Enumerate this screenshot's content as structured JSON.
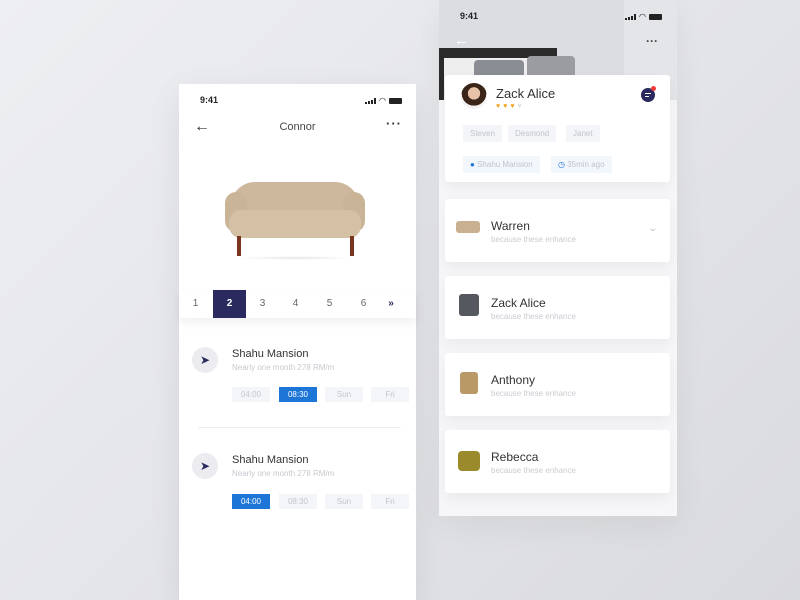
{
  "left": {
    "status_time": "9:41",
    "title": "Connor",
    "pagination": {
      "pages": [
        "1",
        "2",
        "3",
        "4",
        "5",
        "6"
      ],
      "active": "2",
      "next": "»"
    },
    "items": [
      {
        "title": "Shahu Mansion",
        "subtitle": "Nearly one month  278 RM/m",
        "chips": [
          "04:00",
          "08:30",
          "Sun",
          "Fri"
        ],
        "selected": "08:30"
      },
      {
        "title": "Shahu Mansion",
        "subtitle": "Nearly one month  278 RM/m",
        "chips": [
          "04:00",
          "08:30",
          "Sun",
          "Fri"
        ],
        "selected": "04:00"
      }
    ]
  },
  "right": {
    "status_time": "9:41",
    "profile": {
      "name": "Zack Alice",
      "rating": 3,
      "rating_max": 4,
      "tags": [
        "Steven",
        "Desmond",
        "Janet"
      ],
      "location": "Shahu Mansion",
      "time": "35min ago"
    },
    "list": [
      {
        "name": "Warren",
        "subtitle": "because these enhance"
      },
      {
        "name": "Zack Alice",
        "subtitle": "because these enhance"
      },
      {
        "name": "Anthony",
        "subtitle": "because these enhance"
      },
      {
        "name": "Rebecca",
        "subtitle": "because these enhance"
      }
    ]
  },
  "colors": {
    "accent": "#1d75d8",
    "navy": "#2a2a5e",
    "heart": "#f0a019",
    "notify": "#f03a3a"
  }
}
